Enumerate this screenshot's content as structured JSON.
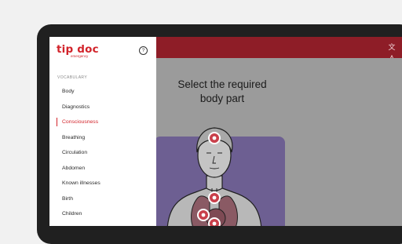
{
  "header": {
    "language_icon": "translate-icon",
    "language_glyph": "文A"
  },
  "main": {
    "title_line1": "Select the required",
    "title_line2": "body part"
  },
  "drawer": {
    "logo_text": "tip doc",
    "logo_subtext": "emergency",
    "help_glyph": "?",
    "section_label": "VOCABULARY",
    "items": [
      {
        "label": "Body"
      },
      {
        "label": "Diagnostics"
      },
      {
        "label": "Consciousness",
        "active": true
      },
      {
        "label": "Breathing"
      },
      {
        "label": "Circulation"
      },
      {
        "label": "Abdomen"
      },
      {
        "label": "Known illnesses"
      },
      {
        "label": "Birth"
      },
      {
        "label": "Children"
      }
    ]
  },
  "colors": {
    "brand_red": "#d2232a",
    "topbar": "#8e1d27",
    "card": "#6d5f92",
    "overlay": "#9b9b9b"
  }
}
